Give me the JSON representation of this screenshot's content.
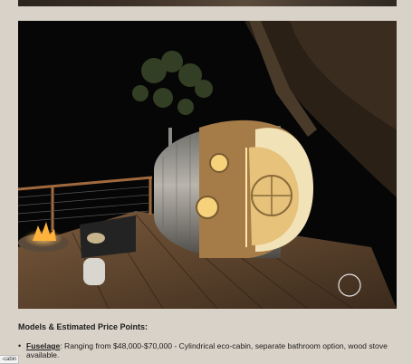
{
  "section": {
    "heading": "Models & Estimated Price Points:"
  },
  "models": [
    {
      "name": "Fuselage",
      "description": ": Ranging from $48,000-$70,000 - Cylindrical eco-cabin, separate bathroom option, wood stove available."
    }
  ],
  "status_bar": {
    "link_preview": "-cabin"
  },
  "photo": {
    "subject": "illuminated-cylindrical-cabin-at-night"
  }
}
